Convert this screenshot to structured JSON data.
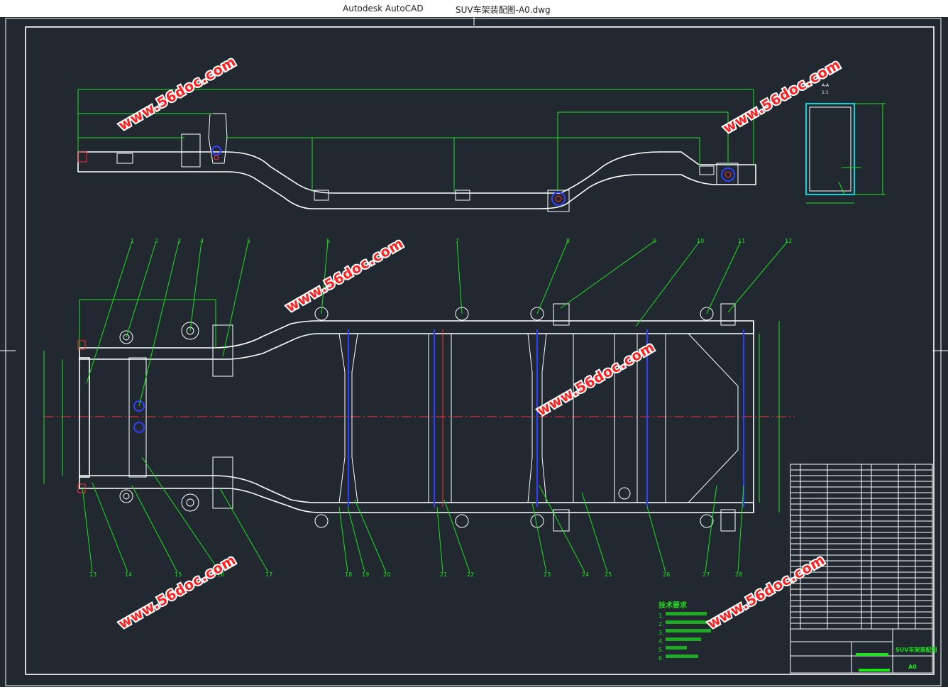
{
  "window": {
    "app_name": "Autodesk AutoCAD",
    "document_title": "SUV车架装配图-A0.dwg"
  },
  "watermark": {
    "text": "www.56doc.com"
  },
  "drawing": {
    "part_numbers_top": [
      "1",
      "2",
      "3",
      "4",
      "5",
      "6",
      "7",
      "8",
      "9",
      "10",
      "11",
      "12"
    ],
    "part_numbers_bottom": [
      "13",
      "14",
      "15",
      "16",
      "17",
      "18",
      "19",
      "20",
      "21",
      "22",
      "23",
      "24",
      "25",
      "26",
      "27",
      "28"
    ],
    "section_view_label": "A-A",
    "section_view_scale": "1:1",
    "tech_notes_title": "技术要求",
    "tech_notes": [
      "1.",
      "2.",
      "3.",
      "4.",
      "5.",
      "6."
    ],
    "title_block_name": "SUV车架装配图",
    "title_block_sheet": "A0"
  },
  "colors": {
    "canvas": "#212830",
    "geometry": "#ffffff",
    "dimensions": "#20e020",
    "centerline": "#ff3030",
    "fasteners": "#3040ff",
    "section_fill": "#00d8e0",
    "watermark": "#ff2020"
  }
}
